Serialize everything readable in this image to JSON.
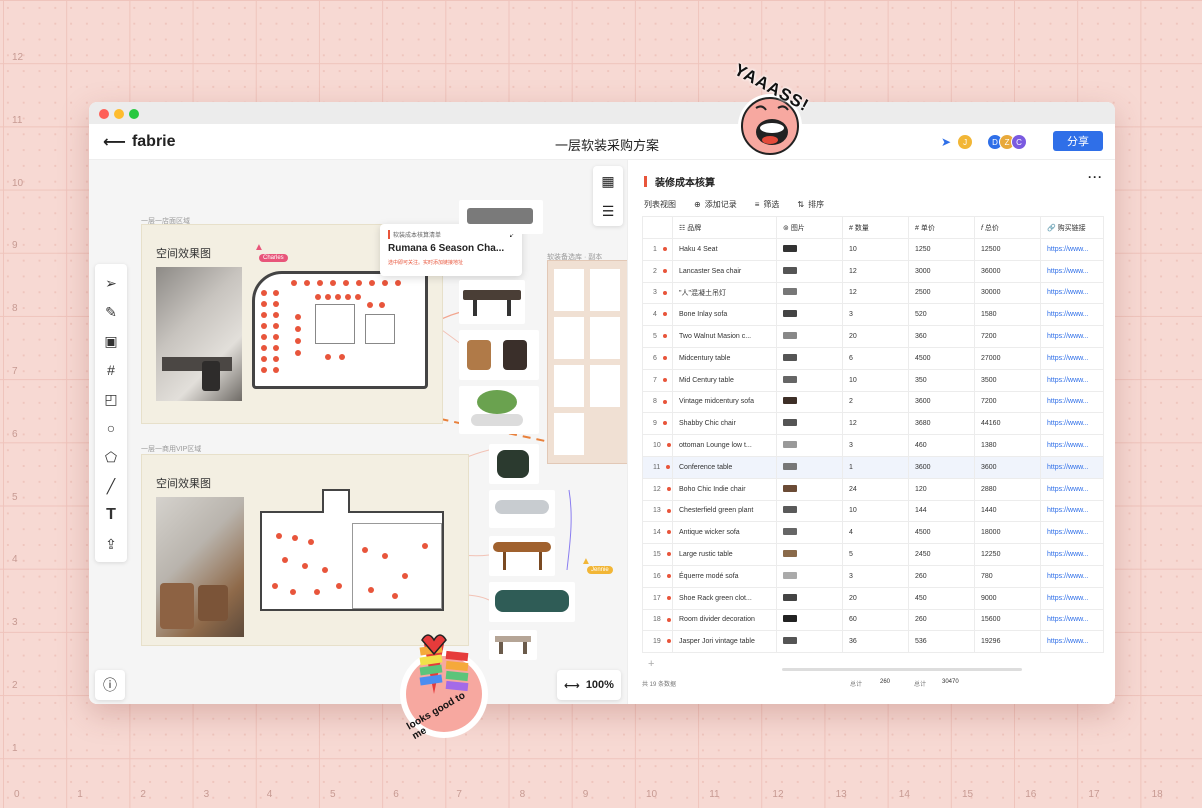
{
  "axis": {
    "y": [
      "12",
      "11",
      "10",
      "9",
      "8",
      "7",
      "6",
      "5",
      "4",
      "3",
      "2",
      "1"
    ],
    "x": [
      "0",
      "1",
      "2",
      "3",
      "4",
      "5",
      "6",
      "7",
      "8",
      "9",
      "10",
      "11",
      "12",
      "13",
      "14",
      "15",
      "16",
      "17",
      "18"
    ]
  },
  "app": {
    "brand": "fabrie",
    "doc_title": "一层软装采购方案",
    "share_label": "分享",
    "avatars": [
      "J",
      "D",
      "Z",
      "C"
    ]
  },
  "canvas": {
    "zone1_label": "一层一店面区域",
    "zone2_label": "一层一商用VIP区域",
    "board1_title": "空间效果图",
    "board2_title": "空间效果图",
    "popup": {
      "subtitle": "软装成本核算清单",
      "title": "Rumana 6 Season Cha...",
      "note": "选中即可关注。实时添加链接地址"
    },
    "cursor_charles": "Charles",
    "cursor_jennie": "Jennie",
    "selection_label": "软装备选库 · 副本",
    "zoom": "100%",
    "tools": [
      "select-tool",
      "pen-tool",
      "frame-tool",
      "crop-tool",
      "sticky-note-tool",
      "circle-tool",
      "polygon-tool",
      "line-tool",
      "text-tool",
      "upload-tool"
    ]
  },
  "panel": {
    "title": "装修成本核算",
    "actions": {
      "list_view": "列表视图",
      "add_record": "添加记录",
      "filter": "筛选",
      "sort": "排序"
    },
    "columns": [
      "品牌",
      "图片",
      "数量",
      "单价",
      "总价",
      "购买链接"
    ],
    "rows": [
      {
        "n": "1",
        "name": "Haku 4 Seat",
        "qty": "10",
        "price": "1250",
        "total": "12500",
        "link": "https://www..."
      },
      {
        "n": "2",
        "name": "Lancaster Sea chair",
        "qty": "12",
        "price": "3000",
        "total": "36000",
        "link": "https://www..."
      },
      {
        "n": "3",
        "name": "\"人\"混凝土吊灯",
        "qty": "12",
        "price": "2500",
        "total": "30000",
        "link": "https://www..."
      },
      {
        "n": "4",
        "name": "Bone Inlay sofa",
        "qty": "3",
        "price": "520",
        "total": "1580",
        "link": "https://www..."
      },
      {
        "n": "5",
        "name": "Two Walnut Masion c...",
        "qty": "20",
        "price": "360",
        "total": "7200",
        "link": "https://www..."
      },
      {
        "n": "6",
        "name": "Midcentury table",
        "qty": "6",
        "price": "4500",
        "total": "27000",
        "link": "https://www..."
      },
      {
        "n": "7",
        "name": "Mid Century table",
        "qty": "10",
        "price": "350",
        "total": "3500",
        "link": "https://www..."
      },
      {
        "n": "8",
        "name": "Vintage midcentury sofa",
        "qty": "2",
        "price": "3600",
        "total": "7200",
        "link": "https://www..."
      },
      {
        "n": "9",
        "name": "Shabby Chic chair",
        "qty": "12",
        "price": "3680",
        "total": "44160",
        "link": "https://www..."
      },
      {
        "n": "10",
        "name": "ottoman Lounge low t...",
        "qty": "3",
        "price": "460",
        "total": "1380",
        "link": "https://www..."
      },
      {
        "n": "11",
        "name": "Conference table",
        "qty": "1",
        "price": "3600",
        "total": "3600",
        "link": "https://www..."
      },
      {
        "n": "12",
        "name": "Boho Chic Indie chair",
        "qty": "24",
        "price": "120",
        "total": "2880",
        "link": "https://www..."
      },
      {
        "n": "13",
        "name": "Chesterfield green plant",
        "qty": "10",
        "price": "144",
        "total": "1440",
        "link": "https://www..."
      },
      {
        "n": "14",
        "name": "Antique wicker sofa",
        "qty": "4",
        "price": "4500",
        "total": "18000",
        "link": "https://www..."
      },
      {
        "n": "15",
        "name": "Large rustic table",
        "qty": "5",
        "price": "2450",
        "total": "12250",
        "link": "https://www..."
      },
      {
        "n": "16",
        "name": "Équerre modé sofa",
        "qty": "3",
        "price": "260",
        "total": "780",
        "link": "https://www..."
      },
      {
        "n": "17",
        "name": "Shoe Rack green clot...",
        "qty": "20",
        "price": "450",
        "total": "9000",
        "link": "https://www..."
      },
      {
        "n": "18",
        "name": "Room divider decoration",
        "qty": "60",
        "price": "260",
        "total": "15600",
        "link": "https://www..."
      },
      {
        "n": "19",
        "name": "Jasper Jori vintage table",
        "qty": "36",
        "price": "536",
        "total": "19296",
        "link": "https://www..."
      }
    ],
    "footer": {
      "count": "共 19 条数据",
      "sum_label_1": "总计",
      "sum_value_1": "260",
      "sum_label_2": "总计",
      "sum_value_2": "30470"
    }
  },
  "stickers": {
    "yaaass": "YAAASS!",
    "looks": "looks good to me"
  }
}
